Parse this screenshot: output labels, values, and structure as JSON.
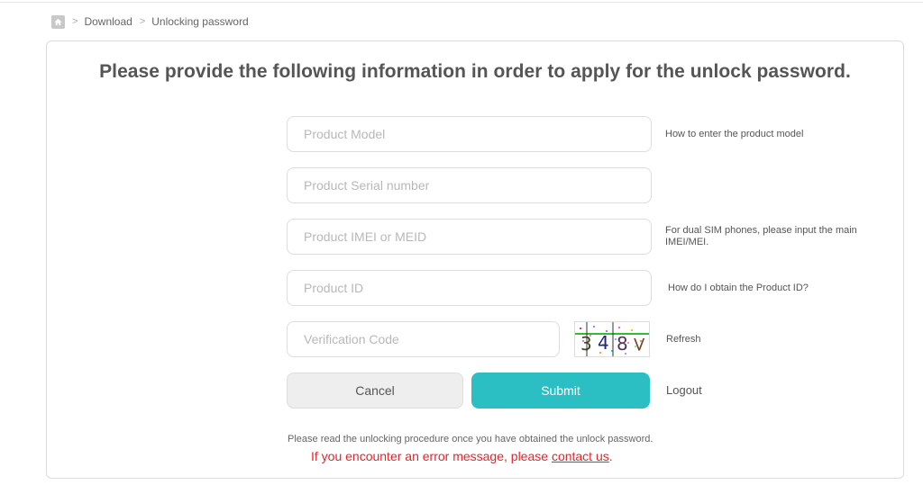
{
  "breadcrumb": {
    "home_icon": "home-icon",
    "separator": ">",
    "items": [
      "Download",
      "Unlocking password"
    ]
  },
  "form": {
    "title": "Please provide the following information in order to apply for the unlock password.",
    "fields": [
      {
        "name": "product-model",
        "placeholder": "Product Model",
        "value": "",
        "hint": "How to enter the product model"
      },
      {
        "name": "product-serial-number",
        "placeholder": "Product Serial number",
        "value": "",
        "hint": ""
      },
      {
        "name": "product-imei",
        "placeholder": "Product IMEI or MEID",
        "value": "",
        "hint": "For dual SIM phones, please input the main IMEI/MEI."
      },
      {
        "name": "product-id",
        "placeholder": "Product ID",
        "value": "",
        "hint": "How do I obtain the Product ID?"
      },
      {
        "name": "verification-code",
        "placeholder": "Verification Code",
        "value": "",
        "hint": "Refresh"
      }
    ],
    "captcha": {
      "text": "348V",
      "chars": [
        "3",
        "4",
        "8",
        "V"
      ]
    },
    "buttons": {
      "cancel": "Cancel",
      "submit": "Submit",
      "logout": "Logout"
    },
    "colors": {
      "submit_bg": "#2bbfc4",
      "error_text": "#e8232a"
    }
  },
  "footer": {
    "note": "Please read the unlocking procedure once you have obtained the unlock password.",
    "error_prefix": "If you encounter an error message, please ",
    "contact_link": "contact us",
    "error_suffix": "."
  }
}
